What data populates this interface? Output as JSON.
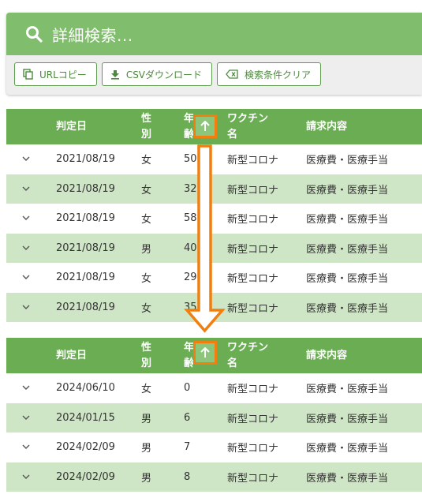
{
  "search": {
    "title": "詳細検索...",
    "buttons": [
      {
        "label": "URLコピー",
        "icon": "copy-icon"
      },
      {
        "label": "CSVダウンロード",
        "icon": "download-icon"
      },
      {
        "label": "検索条件クリア",
        "icon": "backspace-icon"
      }
    ]
  },
  "columns": {
    "date": "判定日",
    "sex_top": "性",
    "sex_bottom": "別",
    "age_top": "年",
    "age_bottom": "齢",
    "vaccine_top": "ワクチン",
    "vaccine_bottom": "名",
    "claim": "請求内容"
  },
  "table_before": [
    {
      "date": "2021/08/19",
      "sex": "女",
      "age": "50",
      "vaccine": "新型コロナ",
      "claim": "医療費・医療手当"
    },
    {
      "date": "2021/08/19",
      "sex": "女",
      "age": "32",
      "vaccine": "新型コロナ",
      "claim": "医療費・医療手当"
    },
    {
      "date": "2021/08/19",
      "sex": "女",
      "age": "58",
      "vaccine": "新型コロナ",
      "claim": "医療費・医療手当"
    },
    {
      "date": "2021/08/19",
      "sex": "男",
      "age": "40",
      "vaccine": "新型コロナ",
      "claim": "医療費・医療手当"
    },
    {
      "date": "2021/08/19",
      "sex": "女",
      "age": "29",
      "vaccine": "新型コロナ",
      "claim": "医療費・医療手当"
    },
    {
      "date": "2021/08/19",
      "sex": "女",
      "age": "35",
      "vaccine": "新型コロナ",
      "claim": "医療費・医療手当"
    }
  ],
  "table_after": [
    {
      "date": "2024/06/10",
      "sex": "女",
      "age": "0",
      "vaccine": "新型コロナ",
      "claim": "医療費・医療手当"
    },
    {
      "date": "2024/01/15",
      "sex": "男",
      "age": "6",
      "vaccine": "新型コロナ",
      "claim": "医療費・医療手当"
    },
    {
      "date": "2024/02/09",
      "sex": "男",
      "age": "7",
      "vaccine": "新型コロナ",
      "claim": "医療費・医療手当"
    },
    {
      "date": "2024/02/09",
      "sex": "男",
      "age": "8",
      "vaccine": "新型コロナ",
      "claim": "医療費・医療手当"
    }
  ],
  "colors": {
    "header": "#6aad52",
    "search_bar": "#80bd6d",
    "row_alt": "#cfe6c6",
    "highlight": "#f07f0f"
  }
}
